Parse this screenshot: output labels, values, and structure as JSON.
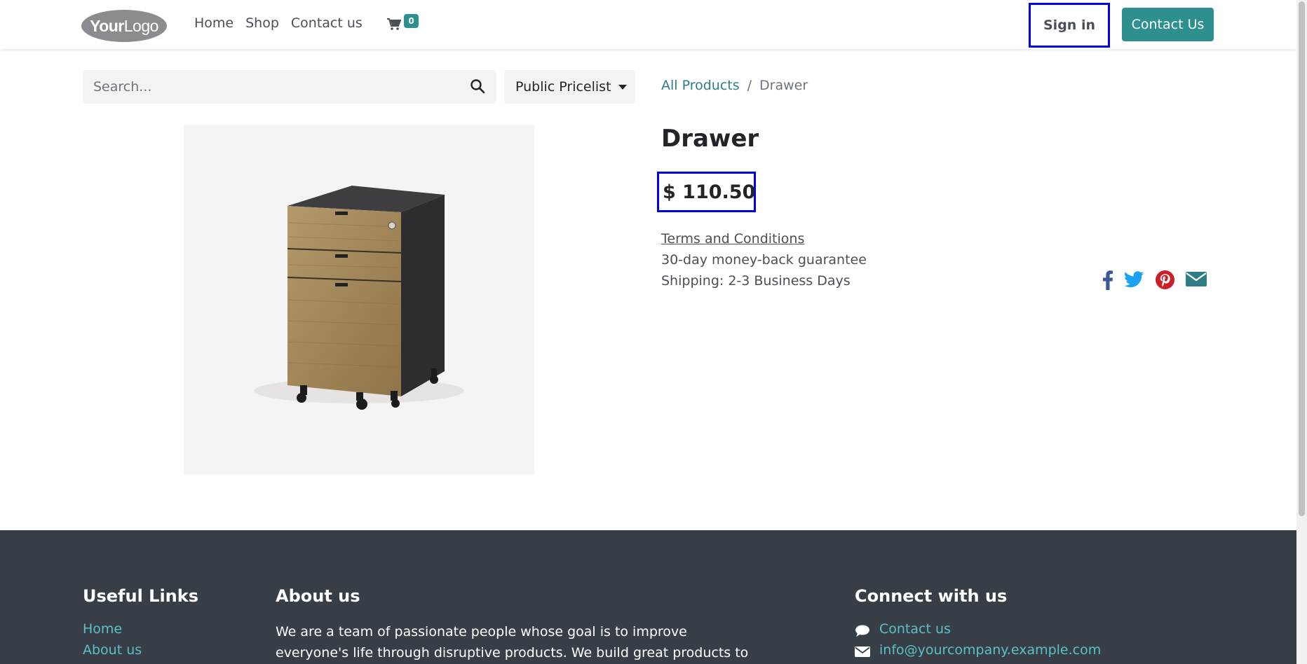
{
  "header": {
    "logo": {
      "bold": "Your",
      "light": "Logo"
    },
    "nav": [
      {
        "label": "Home"
      },
      {
        "label": "Shop"
      },
      {
        "label": "Contact us"
      }
    ],
    "cart_count": "0",
    "sign_in": "Sign in",
    "contact_button": "Contact Us"
  },
  "search": {
    "placeholder": "Search..."
  },
  "pricelist": {
    "selected": "Public Pricelist"
  },
  "breadcrumb": {
    "parent": "All Products",
    "separator": "/",
    "current": "Drawer"
  },
  "product": {
    "name": "Drawer",
    "price": "$ 110.50",
    "terms": "Terms and Conditions",
    "guarantee": "30-day money-back guarantee",
    "shipping": "Shipping: 2-3 Business Days"
  },
  "social": [
    {
      "icon": "facebook-icon",
      "color": "#3b5998"
    },
    {
      "icon": "twitter-icon",
      "color": "#1da1f2"
    },
    {
      "icon": "pinterest-icon",
      "color": "#cb2027"
    },
    {
      "icon": "email-icon",
      "color": "#2e7d87"
    }
  ],
  "footer": {
    "useful_links": {
      "heading": "Useful Links",
      "items": [
        "Home",
        "About us"
      ]
    },
    "about": {
      "heading": "About us",
      "line1": "We are a team of passionate people whose goal is to improve",
      "line2": "everyone's life through disruptive products. We build great products to"
    },
    "connect": {
      "heading": "Connect with us",
      "contact": "Contact us",
      "email": "info@yourcompany.example.com"
    }
  },
  "colors": {
    "accent": "#2e8f8f",
    "highlight_border": "#0000e6",
    "footer_bg": "#383e45"
  }
}
